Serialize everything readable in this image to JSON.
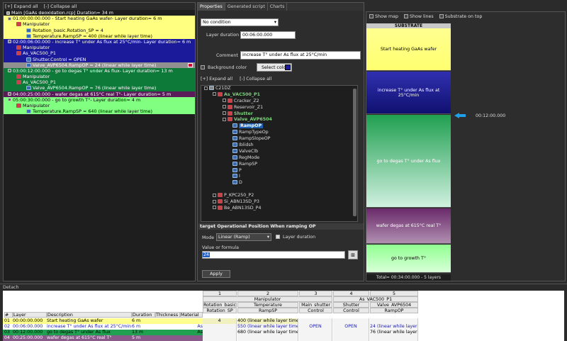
{
  "left_panel": {
    "expand_all": "[+] Expand all",
    "collapse_all": "[-] Collapse all",
    "tree": [
      {
        "text": "Main [GaAs deoxidation.rcp] Duration= 34 m",
        "bg": "#1e1e1e",
        "fg": "#fff",
        "indent": 4,
        "icon": "recipe-icon"
      },
      {
        "text": "01:00:00:00.000 - Start heating GaAs wafer- Layer duration= 6 m",
        "bg": "#ffff80",
        "fg": "#000",
        "indent": 6,
        "icon": "box-icon"
      },
      {
        "text": "Manipulator",
        "bg": "#ffff80",
        "fg": "#000",
        "indent": 18,
        "icon": "red-device-icon"
      },
      {
        "text": "Rotation_basic.Rotation_SP = 4",
        "bg": "#ffff80",
        "fg": "#000",
        "indent": 32,
        "icon": "blue-variable-icon"
      },
      {
        "text": "Temperature.RampSP = 400 (linear while layer time)",
        "bg": "#ffff80",
        "fg": "#000",
        "indent": 32,
        "icon": "blue-variable-icon"
      },
      {
        "text": "02:00:06:00.000 - increase T° under As flux at 25°C/min- Layer duration= 6 m",
        "bg": "#1a1a9a",
        "fg": "#fff",
        "indent": 6,
        "icon": "box-icon"
      },
      {
        "text": "Manipulator",
        "bg": "#1a1a9a",
        "fg": "#fff",
        "indent": 18,
        "icon": "red-device-icon"
      },
      {
        "text": "As_VAC500_P1",
        "bg": "#1a1a9a",
        "fg": "#fff",
        "indent": 18,
        "icon": "red-device-icon"
      },
      {
        "text": "Shutter.Control = OPEN",
        "bg": "#1a1a9a",
        "fg": "#fff",
        "indent": 32,
        "icon": "blue-variable-icon"
      },
      {
        "text": "Valve_AVP6504.RampOP = 24 (linear while layer time)",
        "bg": "#909090",
        "fg": "#fff",
        "indent": 32,
        "icon": "blue-variable-icon"
      },
      {
        "text": "03:00:12:00.000 - go to degas T° under As flux- Layer duration= 13 m",
        "bg": "#0e7a3a",
        "fg": "#fff",
        "indent": 6,
        "icon": "box-icon"
      },
      {
        "text": "Manipulator",
        "bg": "#0e7a3a",
        "fg": "#fff",
        "indent": 18,
        "icon": "red-device-icon"
      },
      {
        "text": "As_VAC500_P1",
        "bg": "#0e7a3a",
        "fg": "#fff",
        "indent": 18,
        "icon": "red-device-icon"
      },
      {
        "text": "Valve_AVP6504.RampOP = 76 (linear while layer time)",
        "bg": "#0e7a3a",
        "fg": "#fff",
        "indent": 32,
        "icon": "blue-variable-icon"
      },
      {
        "text": "04:00:25:00.000 - wafer degas at 615°C real T°- Layer duration= 5 m",
        "bg": "#5a1a5a",
        "fg": "#fff",
        "indent": 6,
        "icon": "box-icon"
      },
      {
        "text": "05:00:30:00.000 - go to growth T°- Layer duration= 4 m",
        "bg": "#80ff80",
        "fg": "#000",
        "indent": 6,
        "icon": "box-icon"
      },
      {
        "text": "Manipulator",
        "bg": "#80ff80",
        "fg": "#000",
        "indent": 18,
        "icon": "red-device-icon"
      },
      {
        "text": "Temperature.RampSP = 640 (linear while layer time)",
        "bg": "#80ff80",
        "fg": "#000",
        "indent": 32,
        "icon": "blue-variable-icon"
      }
    ]
  },
  "middle_panel": {
    "tabs": [
      "Properties",
      "Generated script",
      "Charts"
    ],
    "condition": "No condition",
    "layer_duration_label": "Layer duration",
    "layer_duration_value": "00:06:00.000",
    "comment_label": "Comment",
    "comment_value": "increase T° under As flux at 25°C/min",
    "background_color_label": "Background color",
    "select_color_label": "Select color",
    "select_color_swatch": "#1a1a9a",
    "expand_all": "[+] Expand all",
    "collapse_all": "[-] Collapse all",
    "tree": [
      {
        "text": "C21DZ",
        "indent": 4,
        "style": "",
        "icon": "computer-icon"
      },
      {
        "text": "As_VAC500_P1",
        "indent": 16,
        "style": "g",
        "icon": "red-device-icon"
      },
      {
        "text": "Cracker_Z2",
        "indent": 30,
        "style": "",
        "icon": "red-device-icon"
      },
      {
        "text": "Reservoir_Z1",
        "indent": 30,
        "style": "",
        "icon": "red-device-icon"
      },
      {
        "text": "Shutter",
        "indent": 30,
        "style": "g",
        "icon": "red-device-icon"
      },
      {
        "text": "Valve_AVP6504",
        "indent": 30,
        "style": "g",
        "icon": "red-device-icon"
      },
      {
        "text": "RampOP",
        "indent": 44,
        "style": "sel",
        "icon": "blue-variable-icon"
      },
      {
        "text": "RampTypeOp",
        "indent": 44,
        "style": "",
        "icon": "blue-variable-icon"
      },
      {
        "text": "RampSlopeOP",
        "indent": 44,
        "style": "",
        "icon": "blue-variable-icon"
      },
      {
        "text": "Iblidsh",
        "indent": 44,
        "style": "",
        "icon": "blue-variable-icon"
      },
      {
        "text": "ValveClb",
        "indent": 44,
        "style": "",
        "icon": "blue-variable-icon"
      },
      {
        "text": "RegMode",
        "indent": 44,
        "style": "",
        "icon": "blue-variable-icon"
      },
      {
        "text": "RampSP",
        "indent": 44,
        "style": "",
        "icon": "blue-variable-icon"
      },
      {
        "text": "P",
        "indent": 44,
        "style": "",
        "icon": "blue-variable-icon"
      },
      {
        "text": "I",
        "indent": 44,
        "style": "",
        "icon": "blue-variable-icon"
      },
      {
        "text": "D",
        "indent": 44,
        "style": "",
        "icon": "blue-variable-icon"
      },
      {
        "text": "",
        "indent": 44,
        "style": "",
        "icon": ""
      },
      {
        "text": "P_KPC250_P2",
        "indent": 16,
        "style": "",
        "icon": "red-device-icon"
      },
      {
        "text": "Si_ABN13SD_P3",
        "indent": 16,
        "style": "",
        "icon": "red-device-icon"
      },
      {
        "text": "Be_ABN13SD_P4",
        "indent": 16,
        "style": "",
        "icon": "red-device-icon"
      },
      {
        "text": "",
        "indent": 16,
        "style": "",
        "icon": ""
      }
    ],
    "section_title": "target Operational Position When ramping OP",
    "mode_label": "Mode",
    "mode_value": "Linear (Ramp)",
    "layer_duration_checkbox_label": "Layer duration",
    "value_formula_label": "Value or formula",
    "value_formula_value": "24",
    "apply_label": "Apply"
  },
  "right_panel": {
    "show_map": "Show map",
    "show_lines": "Show lines",
    "substrate_on_top": "Substrate on top",
    "substrate_label": "SUBSTRATE",
    "time_marker": "00:12:00.000",
    "total": "Total= 00:34:00.000 - 5 layers",
    "layers": [
      {
        "label": "Start heating GaAs wafer",
        "color_top": "#ffff90",
        "color_bottom": "#ffff70",
        "fg": "#000",
        "minutes": 6
      },
      {
        "label": "increase T° under As flux at 25°C/min",
        "color_top": "#3030b0",
        "color_bottom": "#101070",
        "fg": "#fff",
        "minutes": 6
      },
      {
        "label": "go to degas T° under As flux",
        "color_top": "#20a050",
        "color_bottom": "#d0f0e0",
        "fg": "#fff",
        "minutes": 13
      },
      {
        "label": "wafer degas at 615°C real T°",
        "color_top": "#6a2a6a",
        "color_bottom": "#b090b0",
        "fg": "#fff",
        "minutes": 5
      },
      {
        "label": "go to growth T°",
        "color_top": "#90ff90",
        "color_bottom": "#d8ffd8",
        "fg": "#000",
        "minutes": 4
      }
    ]
  },
  "bottom": {
    "detach": "Detach",
    "group_numbers": [
      "1",
      "2",
      "3",
      "4",
      "5"
    ],
    "group_names": [
      "Manipulator",
      "As_VAC500_P1"
    ],
    "sub_headers": [
      "Rotation_basic",
      "Temperature",
      "Main_shutter",
      "Shutter",
      "Valve_AVP6504"
    ],
    "prop_headers": [
      "Rotation_SP",
      "RampSP",
      "Control",
      "Control",
      "RampOP"
    ],
    "left_headers": [
      "#",
      "Layer",
      "Description",
      "Duration",
      "Thickness",
      "Material"
    ],
    "rows": [
      {
        "num": "01",
        "layer": "00:00:00.000",
        "desc": "Start heating GaAs wafer",
        "dur": "6 m",
        "mat": "",
        "c1": "4",
        "c2": "400 (linear while layer time)",
        "c3": "",
        "c4": "",
        "c5": "",
        "bg": "#ffff90",
        "fg": "#000"
      },
      {
        "num": "02",
        "layer": "00:06:00.000",
        "desc": "increase T° under As flux at 25°C/min",
        "dur": "6 m",
        "mat": "As",
        "c1": "",
        "c2": "550 (linear while layer time)",
        "c3": "OPEN",
        "c4": "OPEN",
        "c5": "24 (linear while layer time)",
        "bg": "#ffffff",
        "fg": "#1a1aaa"
      },
      {
        "num": "03",
        "layer": "00:12:00.000",
        "desc": "go to degas T° under As flux",
        "dur": "13 m",
        "mat": "As",
        "c1": "",
        "c2": "680 (linear while layer time)",
        "c3": "",
        "c4": "",
        "c5": "76 (linear while layer time)",
        "bg": "#20a050",
        "fg": "#000"
      },
      {
        "num": "04",
        "layer": "00:25:00.000",
        "desc": "wafer degas at 615°C real T°",
        "dur": "5 m",
        "mat": "",
        "c1": "",
        "c2": "",
        "c3": "",
        "c4": "",
        "c5": "",
        "bg": "#8a5a8a",
        "fg": "#fff"
      }
    ]
  }
}
